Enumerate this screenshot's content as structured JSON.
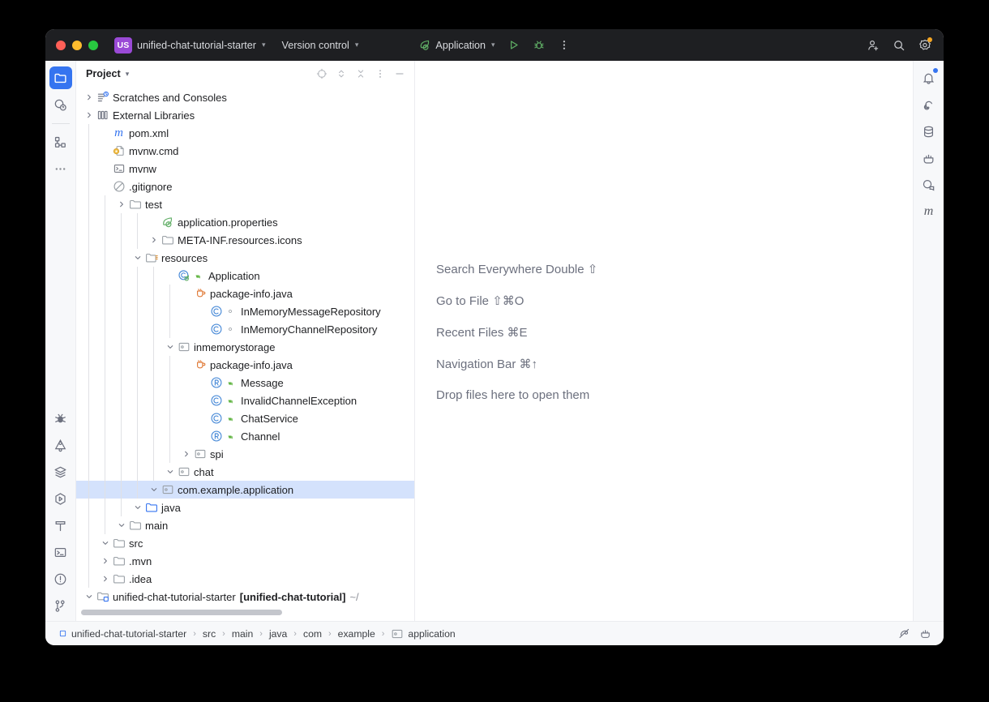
{
  "titlebar": {
    "project_badge": "US",
    "project_name": "unified-chat-tutorial-starter",
    "version_control": "Version control",
    "run_config": "Application",
    "buttons": {
      "run": "run-button",
      "debug": "debug-button",
      "more": "more-actions",
      "share": "share-button",
      "search": "search-button",
      "settings": "settings-button"
    }
  },
  "left_rail": {
    "items": [
      {
        "name": "project-tool-window",
        "icon": "folder-icon",
        "active": true
      },
      {
        "name": "ai-assistant-tool-window",
        "icon": "ai-assistant-icon",
        "active": false
      },
      {
        "name": "structure-tool-window",
        "icon": "structure-icon",
        "active": false
      },
      {
        "name": "more-tool-windows",
        "icon": "ellipsis-icon",
        "active": false
      }
    ],
    "bottom_items": [
      {
        "name": "debug-tool-window",
        "icon": "bug-icon"
      },
      {
        "name": "endpoints-tool-window",
        "icon": "graphql-icon"
      },
      {
        "name": "services-tool-window",
        "icon": "layers-icon"
      },
      {
        "name": "run-tool-window",
        "icon": "run-hex-icon"
      },
      {
        "name": "build-tool-window",
        "icon": "hammer-icon"
      },
      {
        "name": "terminal-tool-window",
        "icon": "terminal-icon"
      },
      {
        "name": "problems-tool-window",
        "icon": "warning-circle-icon"
      },
      {
        "name": "version-control-tool-window",
        "icon": "branch-icon"
      }
    ]
  },
  "right_rail": {
    "items": [
      {
        "name": "notifications-tool-window",
        "icon": "bell-icon",
        "badge": true
      },
      {
        "name": "ai-chat-tool-window",
        "icon": "spiral-icon",
        "badge": false
      },
      {
        "name": "database-tool-window",
        "icon": "database-icon",
        "badge": false
      },
      {
        "name": "docker-tool-window",
        "icon": "docker-icon",
        "badge": false
      },
      {
        "name": "kubernetes-tool-window",
        "icon": "kubernetes-icon",
        "badge": false
      },
      {
        "name": "maven-tool-window",
        "icon": "maven-m-icon",
        "badge": false
      }
    ]
  },
  "panel": {
    "title": "Project",
    "header_buttons": [
      {
        "name": "select-opened-file-button",
        "icon": "crosshair-icon"
      },
      {
        "name": "expand-collapse-button",
        "icon": "updown-chevrons-icon"
      },
      {
        "name": "collapse-all-button",
        "icon": "collapse-all-icon"
      },
      {
        "name": "panel-options-button",
        "icon": "vertical-ellipsis-icon"
      },
      {
        "name": "hide-panel-button",
        "icon": "minus-icon"
      }
    ]
  },
  "tree": [
    {
      "depth": 0,
      "twisty": "down",
      "icon": "module-folder-icon",
      "label": "unified-chat-tutorial-starter",
      "suffix": "[unified-chat-tutorial]",
      "path": "~/",
      "selected": false,
      "guides": 0
    },
    {
      "depth": 1,
      "twisty": "right",
      "icon": "folder-icon",
      "label": ".idea",
      "selected": false,
      "guides": 1
    },
    {
      "depth": 1,
      "twisty": "right",
      "icon": "folder-icon",
      "label": ".mvn",
      "selected": false,
      "guides": 1
    },
    {
      "depth": 1,
      "twisty": "down",
      "icon": "folder-icon",
      "label": "src",
      "selected": false,
      "guides": 1
    },
    {
      "depth": 2,
      "twisty": "down",
      "icon": "folder-icon",
      "label": "main",
      "selected": false,
      "guides": 2
    },
    {
      "depth": 3,
      "twisty": "down",
      "icon": "source-folder-icon",
      "label": "java",
      "selected": false,
      "guides": 3
    },
    {
      "depth": 4,
      "twisty": "down",
      "icon": "package-icon",
      "label": "com.example.application",
      "selected": true,
      "guides": 4
    },
    {
      "depth": 5,
      "twisty": "down",
      "icon": "package-icon",
      "label": "chat",
      "selected": false,
      "guides": 5
    },
    {
      "depth": 6,
      "twisty": "right",
      "icon": "package-icon",
      "label": "spi",
      "selected": false,
      "guides": 6
    },
    {
      "depth": 7,
      "twisty": "none",
      "icon": "record-icon",
      "modifier": "abstract-green-icon",
      "label": "Channel",
      "selected": false,
      "guides": 6
    },
    {
      "depth": 7,
      "twisty": "none",
      "icon": "class-icon",
      "modifier": "abstract-green-icon",
      "label": "ChatService",
      "selected": false,
      "guides": 6
    },
    {
      "depth": 7,
      "twisty": "none",
      "icon": "class-icon",
      "modifier": "abstract-green-icon",
      "label": "InvalidChannelException",
      "selected": false,
      "guides": 6
    },
    {
      "depth": 7,
      "twisty": "none",
      "icon": "record-icon",
      "modifier": "abstract-green-icon",
      "label": "Message",
      "selected": false,
      "guides": 6
    },
    {
      "depth": 6,
      "twisty": "none",
      "icon": "java-file-icon",
      "label": "package-info.java",
      "selected": false,
      "guides": 6
    },
    {
      "depth": 5,
      "twisty": "down",
      "icon": "package-icon",
      "label": "inmemorystorage",
      "selected": false,
      "guides": 5
    },
    {
      "depth": 7,
      "twisty": "none",
      "icon": "class-icon",
      "modifier": "package-private-icon",
      "label": "InMemoryChannelRepository",
      "selected": false,
      "guides": 6
    },
    {
      "depth": 7,
      "twisty": "none",
      "icon": "class-icon",
      "modifier": "package-private-icon",
      "label": "InMemoryMessageRepository",
      "selected": false,
      "guides": 6
    },
    {
      "depth": 6,
      "twisty": "none",
      "icon": "java-file-icon",
      "label": "package-info.java",
      "selected": false,
      "guides": 6
    },
    {
      "depth": 5,
      "twisty": "none",
      "icon": "spring-class-icon",
      "modifier": "abstract-green-icon",
      "label": "Application",
      "selected": false,
      "guides": 5
    },
    {
      "depth": 3,
      "twisty": "down",
      "icon": "resources-folder-icon",
      "label": "resources",
      "selected": false,
      "guides": 3
    },
    {
      "depth": 4,
      "twisty": "right",
      "icon": "folder-icon",
      "label": "META-INF.resources.icons",
      "selected": false,
      "guides": 4
    },
    {
      "depth": 4,
      "twisty": "none",
      "icon": "spring-leaf-icon",
      "label": "application.properties",
      "selected": false,
      "guides": 4
    },
    {
      "depth": 2,
      "twisty": "right",
      "icon": "folder-icon",
      "label": "test",
      "selected": false,
      "guides": 2
    },
    {
      "depth": 1,
      "twisty": "none",
      "icon": "gitignore-icon",
      "label": ".gitignore",
      "selected": false,
      "guides": 1
    },
    {
      "depth": 1,
      "twisty": "none",
      "icon": "shell-script-icon",
      "label": "mvnw",
      "selected": false,
      "guides": 1
    },
    {
      "depth": 1,
      "twisty": "none",
      "icon": "cmd-file-icon",
      "label": "mvnw.cmd",
      "selected": false,
      "guides": 1
    },
    {
      "depth": 1,
      "twisty": "none",
      "icon": "maven-m-icon",
      "label": "pom.xml",
      "selected": false,
      "guides": 1
    },
    {
      "depth": 0,
      "twisty": "right",
      "icon": "external-libraries-icon",
      "label": "External Libraries",
      "selected": false,
      "guides": 0
    },
    {
      "depth": 0,
      "twisty": "right",
      "icon": "scratches-icon",
      "label": "Scratches and Consoles",
      "selected": false,
      "guides": 0
    }
  ],
  "editor": {
    "hints": [
      "Search Everywhere Double ⇧",
      "Go to File ⇧⌘O",
      "Recent Files ⌘E",
      "Navigation Bar ⌘↑",
      "Drop files here to open them"
    ]
  },
  "status": {
    "breadcrumbs": [
      {
        "label": "unified-chat-tutorial-starter",
        "icon": "module-icon"
      },
      {
        "label": "src",
        "icon": ""
      },
      {
        "label": "main",
        "icon": ""
      },
      {
        "label": "java",
        "icon": ""
      },
      {
        "label": "com",
        "icon": ""
      },
      {
        "label": "example",
        "icon": ""
      },
      {
        "label": "application",
        "icon": "package-icon"
      }
    ],
    "right_buttons": [
      {
        "name": "inspections-widget",
        "icon": "no-inspections-icon"
      },
      {
        "name": "docker-widget",
        "icon": "docker-icon"
      }
    ]
  },
  "colors": {
    "titlebar_bg": "#1e1f22",
    "accent_blue": "#3574f0",
    "selection_blue": "#d4e2fc",
    "badge_purple": "#9a4ad6",
    "run_green": "#5fad65",
    "notification_orange": "#f5a623",
    "folder_gray": "#9aa0a6",
    "folder_blue": "#3574f0",
    "class_blue": "#4a8bd8",
    "modifier_green": "#62b543",
    "java_orange": "#e07b39"
  }
}
